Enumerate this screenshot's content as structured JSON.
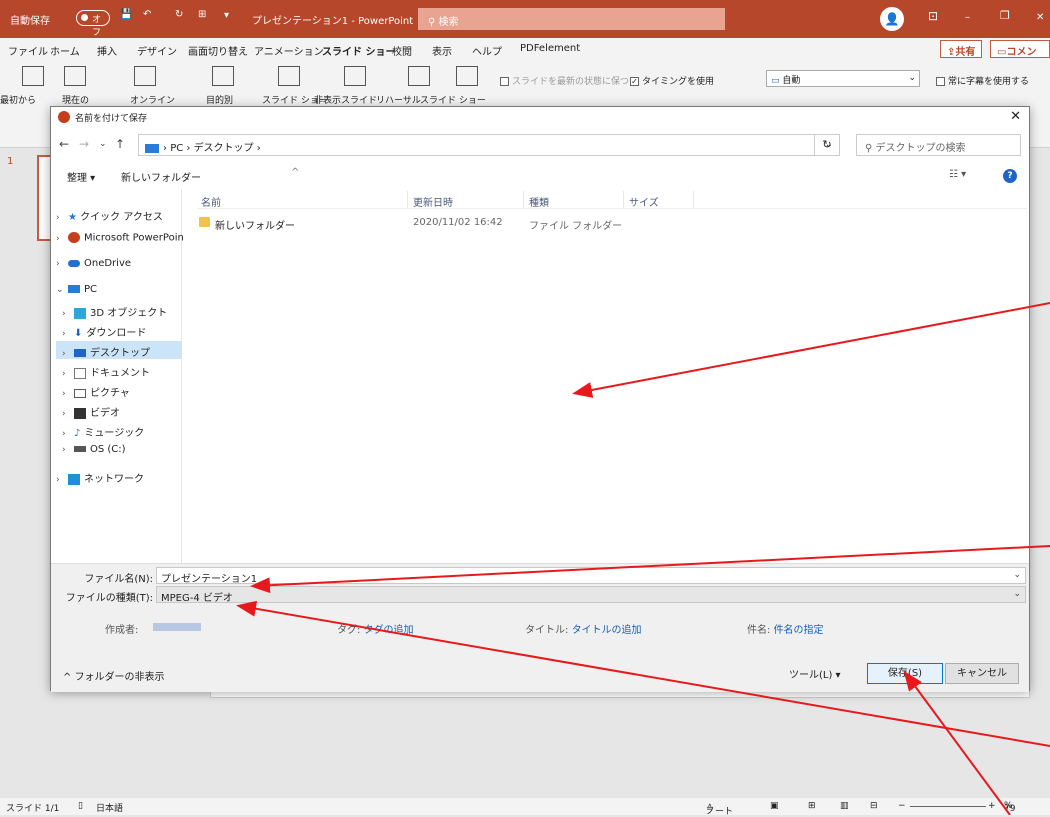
{
  "app": {
    "autosave_label": "自動保存",
    "autosave_state": "オフ",
    "doc_title": "プレゼンテーション1 - PowerPoint",
    "search_placeholder": "検索"
  },
  "menu": {
    "items": [
      "ファイル",
      "ホーム",
      "挿入",
      "デザイン",
      "画面切り替え",
      "アニメーション",
      "スライド ショー",
      "校閲",
      "表示",
      "ヘルプ",
      "PDFelement"
    ],
    "active": "スライド ショー",
    "share": "共有",
    "comment": "コメント"
  },
  "ribbon": {
    "buttons": [
      "最初から",
      "現在の",
      "オンライン",
      "目的別",
      "スライド ショー",
      "非表示スライド",
      "リハーサル",
      "スライド ショー"
    ],
    "checks": [
      "スライドを最新の状態に保つ",
      "タイミングを使用",
      "常に字幕を使用する"
    ],
    "monitor": "自動"
  },
  "thumbs": {
    "slide_number": "1"
  },
  "status": {
    "slide": "スライド 1/1",
    "lang": "日本語",
    "notes": "ノート",
    "zoom": "79"
  },
  "dialog": {
    "title": "名前を付けて保存",
    "breadcrumb": [
      "PC",
      "デスクトップ"
    ],
    "search_placeholder": "デスクトップの検索",
    "organize": "整理 ▾",
    "new_folder": "新しいフォルダー",
    "nav": [
      {
        "label": "クイック アクセス",
        "icon": "star-icon",
        "color": "#1e78d7"
      },
      {
        "label": "Microsoft PowerPoin",
        "icon": "powerpoint-icon",
        "color": "#c43e1c"
      },
      {
        "label": "OneDrive",
        "icon": "cloud-icon",
        "color": "#1f6fd6"
      },
      {
        "label": "PC",
        "icon": "pc-icon",
        "color": "#2a7ad8"
      },
      {
        "label": "3D オブジェクト",
        "icon": "cube-icon",
        "color": "#2aa8d8"
      },
      {
        "label": "ダウンロード",
        "icon": "download-icon",
        "color": "#1f65c8"
      },
      {
        "label": "デスクトップ",
        "icon": "desktop-icon",
        "color": "#1f65c8"
      },
      {
        "label": "ドキュメント",
        "icon": "document-icon",
        "color": "#777777"
      },
      {
        "label": "ピクチャ",
        "icon": "picture-icon",
        "color": "#5a5a5a"
      },
      {
        "label": "ビデオ",
        "icon": "video-icon",
        "color": "#333333"
      },
      {
        "label": "ミュージック",
        "icon": "music-icon",
        "color": "#1f6fd6"
      },
      {
        "label": "OS (C:)",
        "icon": "drive-icon",
        "color": "#555555"
      },
      {
        "label": "ネットワーク",
        "icon": "network-icon",
        "color": "#1f8fd6"
      }
    ],
    "columns": [
      "名前",
      "更新日時",
      "種類",
      "サイズ"
    ],
    "files": [
      {
        "name": "新しいフォルダー",
        "date": "2020/11/02 16:42",
        "type": "ファイル フォルダー"
      }
    ],
    "form": {
      "filename_label": "ファイル名(N):",
      "filename": "プレゼンテーション1",
      "filetype_label": "ファイルの種類(T):",
      "filetype": "MPEG-4 ビデオ",
      "author_label": "作成者:",
      "tags_label": "タグ:",
      "tags_link": "タグの追加",
      "title_label": "タイトル:",
      "title_link": "タイトルの追加",
      "subject_label": "件名:",
      "subject_link": "件名の指定"
    },
    "hide_folders": "フォルダーの非表示",
    "tools": "ツール(L)",
    "save": "保存(S)",
    "cancel": "キャンセル"
  },
  "annotation_color": "#e8191c"
}
